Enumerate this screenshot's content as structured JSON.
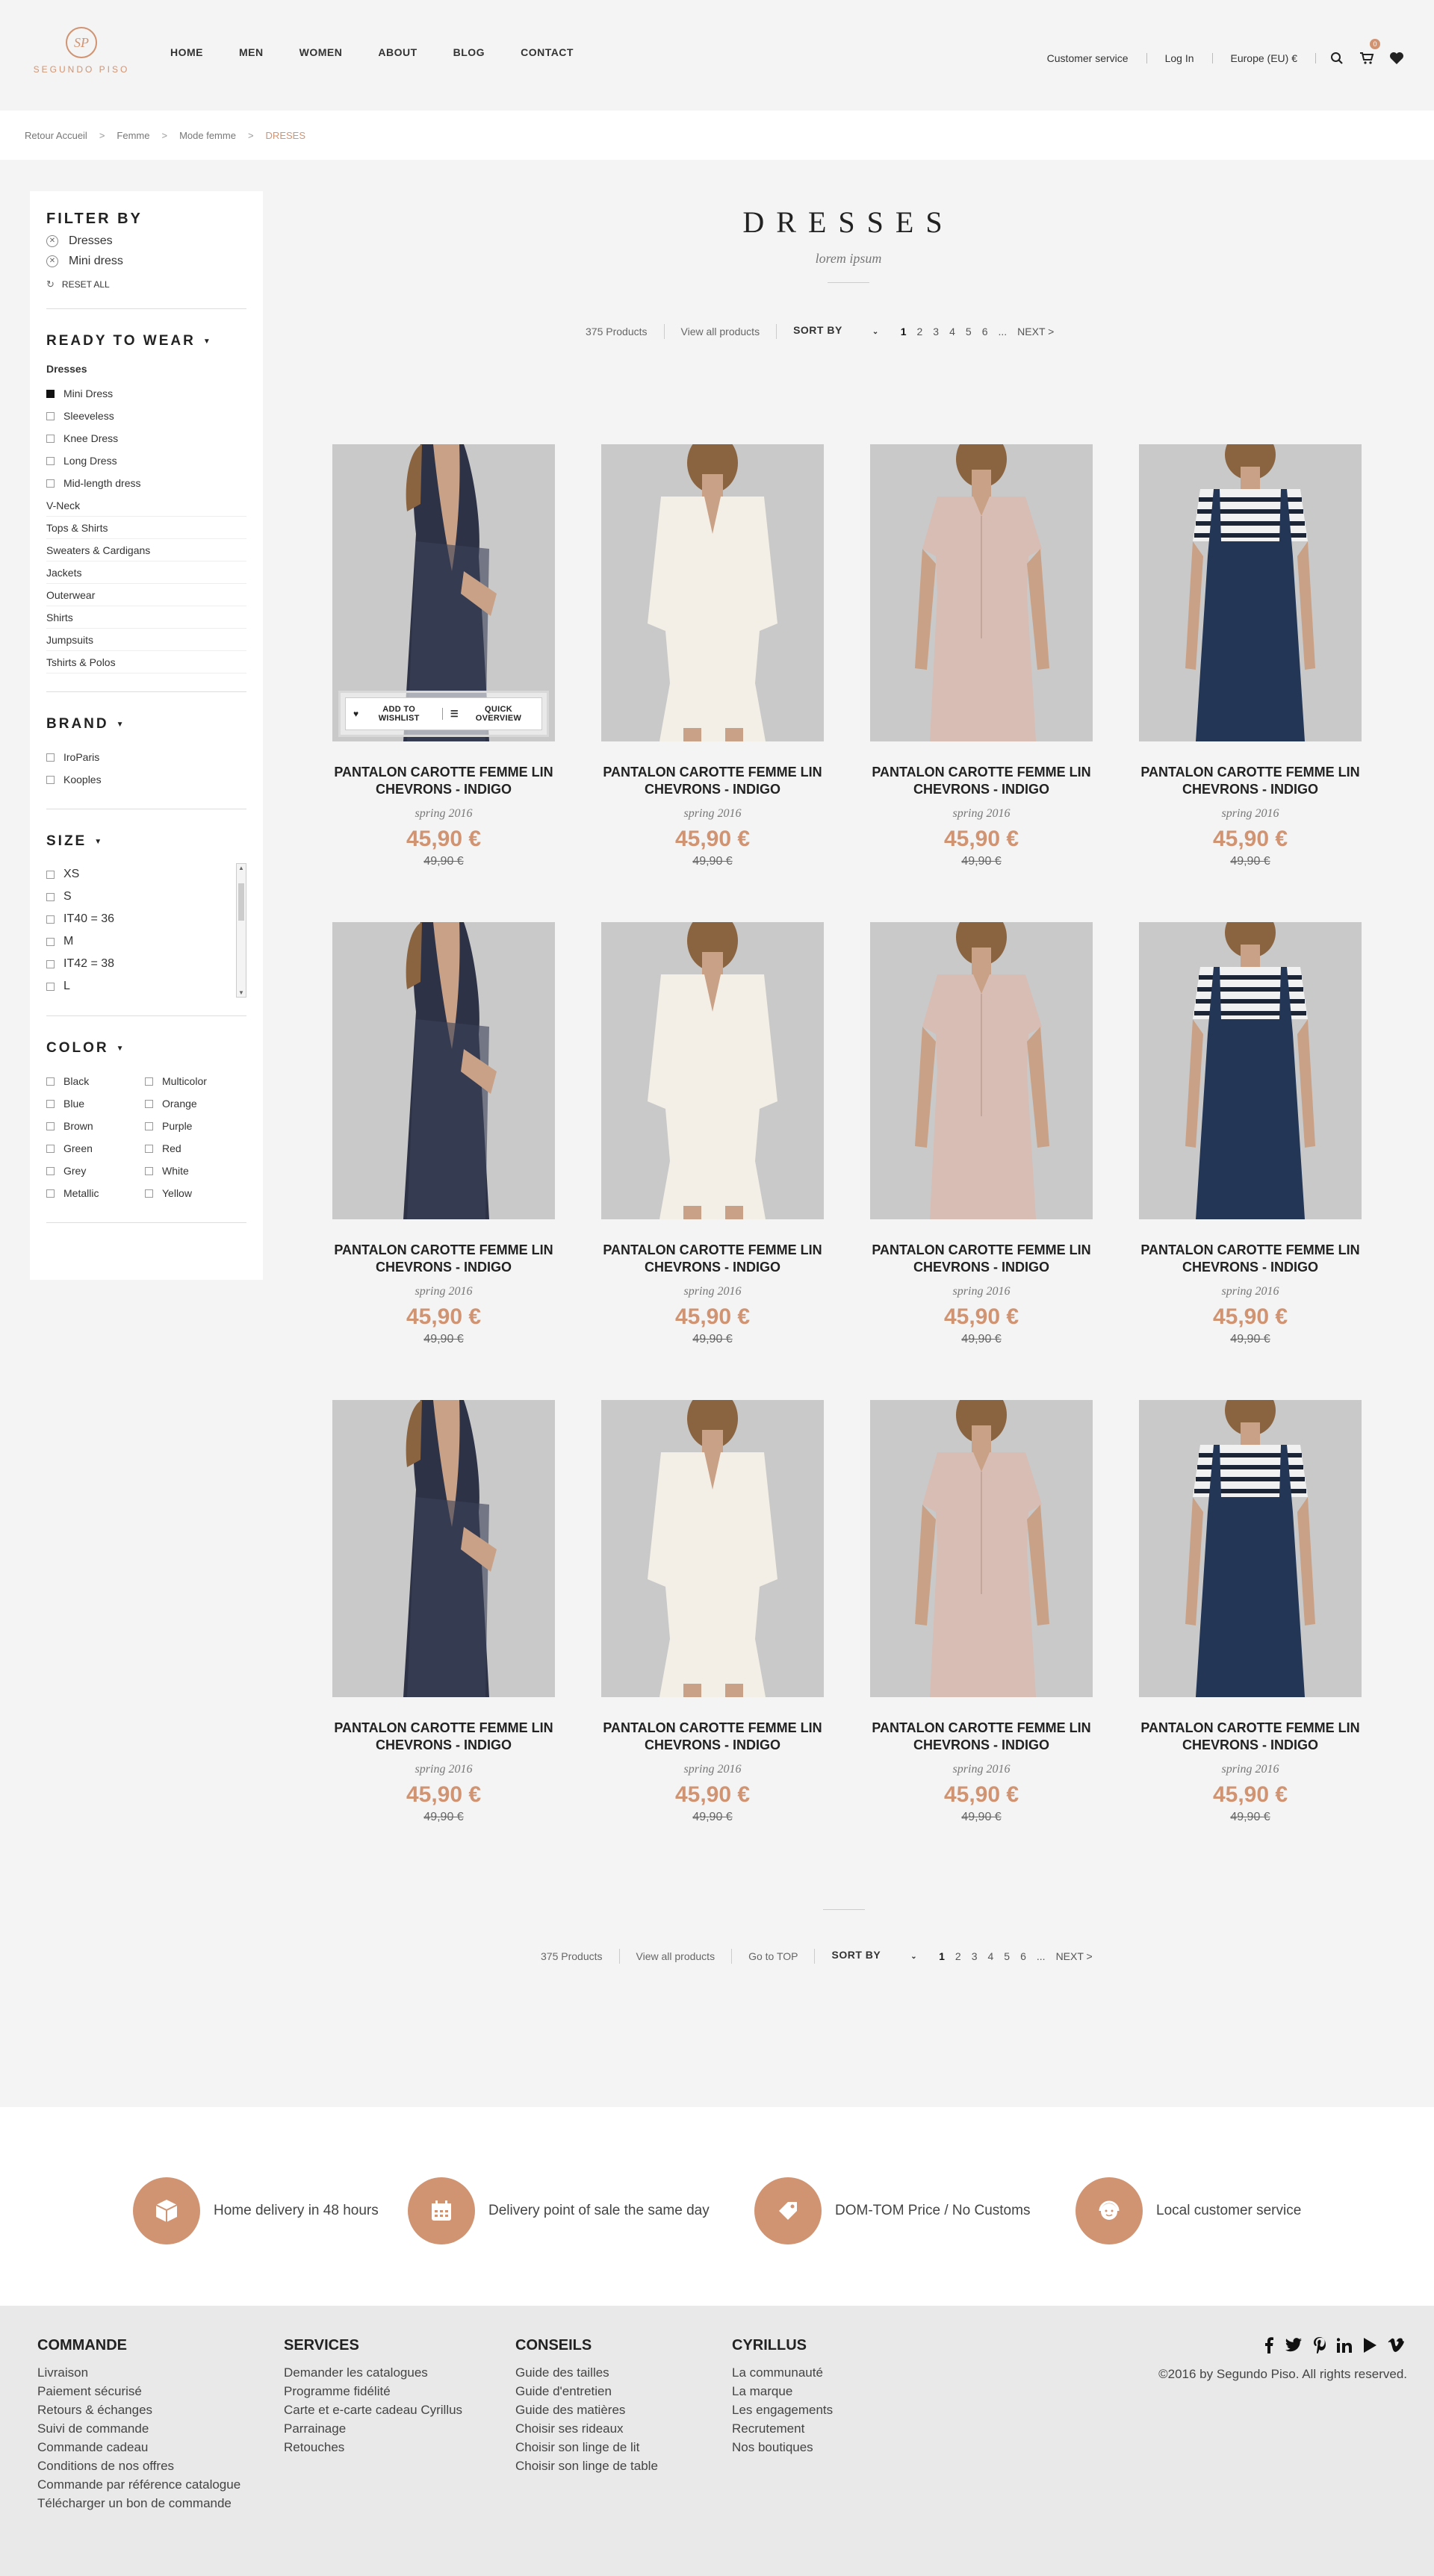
{
  "brand": {
    "monogram": "SP",
    "name": "SEGUNDO PISO"
  },
  "nav": [
    "HOME",
    "MEN",
    "WOMEN",
    "ABOUT",
    "BLOG",
    "CONTACT"
  ],
  "utility": {
    "customer_service": "Customer service",
    "login": "Log In",
    "region": "Europe (EU) €",
    "cart_count": "0"
  },
  "breadcrumb": [
    "Retour Accueil",
    "Femme",
    "Mode femme",
    "DRESES"
  ],
  "breadcrumb_sep": ">",
  "filter": {
    "title": "FILTER BY",
    "active": [
      "Dresses",
      "Mini dress"
    ],
    "reset": "RESET ALL"
  },
  "ready_to_wear": {
    "title": "READY TO WEAR",
    "category": "Dresses",
    "checkbox_items": [
      {
        "label": "Mini Dress",
        "checked": true
      },
      {
        "label": "Sleeveless",
        "checked": false
      },
      {
        "label": "Knee Dress",
        "checked": false
      },
      {
        "label": "Long Dress",
        "checked": false
      },
      {
        "label": "Mid-length dress",
        "checked": false
      }
    ],
    "links": [
      "V-Neck",
      "Tops & Shirts",
      "Sweaters & Cardigans",
      "Jackets",
      "Outerwear",
      "Shirts",
      "Jumpsuits",
      "Tshirts & Polos"
    ]
  },
  "brand_filter": {
    "title": "BRAND",
    "items": [
      "IroParis",
      "Kooples"
    ]
  },
  "size_filter": {
    "title": "SIZE",
    "items": [
      "XS",
      "S",
      "IT40 = 36",
      "M",
      "IT42 = 38",
      "L"
    ]
  },
  "color_filter": {
    "title": "COLOR",
    "items": [
      "Black",
      "Multicolor",
      "Blue",
      "Orange",
      "Brown",
      "Purple",
      "Green",
      "Red",
      "Grey",
      "White",
      "Metallic",
      "Yellow"
    ]
  },
  "listing": {
    "title": "DRESSES",
    "subtitle": "lorem ipsum",
    "product_count": "375 Products",
    "view_all": "View all products",
    "go_top": "Go to TOP",
    "sort_by": "SORT BY",
    "pages": [
      "1",
      "2",
      "3",
      "4",
      "5",
      "6",
      "...",
      "NEXT >"
    ]
  },
  "product_template": {
    "title": "PANTALON CAROTTE FEMME LIN CHEVRONS - INDIGO",
    "season": "spring 2016",
    "price": "45,90 €",
    "old_price": "49,90 €"
  },
  "overlay": {
    "wishlist": "ADD TO WISHLIST",
    "quick": "QUICK OVERVIEW"
  },
  "services": [
    {
      "icon": "box-icon",
      "label": "Home delivery in 48 hours"
    },
    {
      "icon": "calendar-icon",
      "label": "Delivery point of sale the same day"
    },
    {
      "icon": "tag-icon",
      "label": "DOM-TOM Price / No Customs"
    },
    {
      "icon": "headset-icon",
      "label": "Local customer service"
    }
  ],
  "footer": {
    "columns": [
      {
        "title": "COMMANDE",
        "links": [
          "Livraison",
          "Paiement sécurisé",
          "Retours & échanges",
          "Suivi de commande",
          "Commande cadeau",
          "Conditions de nos offres",
          "Commande par référence catalogue",
          "Télécharger un bon de commande"
        ]
      },
      {
        "title": "SERVICES",
        "links": [
          "Demander les catalogues",
          "Programme fidélité",
          "Carte et e-carte cadeau Cyrillus",
          "Parrainage",
          "Retouches"
        ]
      },
      {
        "title": "CONSEILS",
        "links": [
          "Guide des tailles",
          "Guide d'entretien",
          "Guide des matières",
          "Choisir ses rideaux",
          "Choisir son linge de lit",
          "Choisir son linge de table"
        ]
      },
      {
        "title": "CYRILLUS",
        "links": [
          "La communauté",
          "La marque",
          "Les engagements",
          "Recrutement",
          "Nos boutiques"
        ]
      }
    ],
    "copyright": "©2016 by Segundo Piso. All rights reserved.",
    "social": [
      "facebook-icon",
      "twitter-icon",
      "pinterest-icon",
      "linkedin-icon",
      "youtube-icon",
      "vimeo-icon"
    ]
  },
  "colors": {
    "accent": "#d19473",
    "text": "#222222",
    "background": "#f4f4f4"
  }
}
